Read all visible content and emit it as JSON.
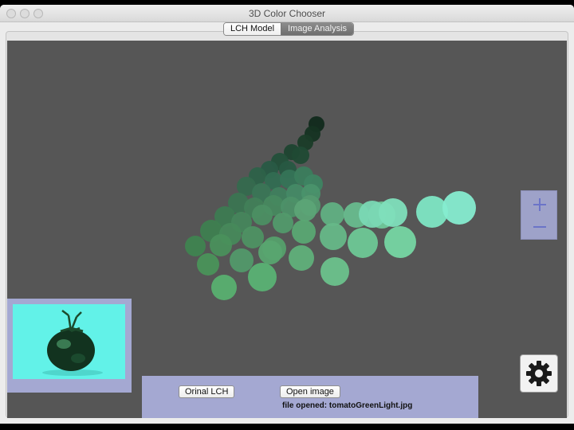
{
  "window": {
    "title": "3D Color Chooser"
  },
  "tabs": [
    {
      "label": "LCH Model",
      "active": false
    },
    {
      "label": "Image Analysis",
      "active": true
    }
  ],
  "zoom": {
    "plus_icon": "plus-icon",
    "minus_icon": "minus-icon"
  },
  "controls": {
    "original_lch_label": "Orinal LCH",
    "open_image_label": "Open image",
    "status_text": "file opened: tomatoGreenLight.jpg"
  },
  "thumbnail": {
    "subject": "green tomato with stem on cyan background"
  },
  "settings": {
    "icon": "gear-icon"
  },
  "colors": {
    "viewport_bg": "#565656",
    "panel_accent": "#a4a8d2",
    "thumb_bg": "#62f2e8",
    "tomato_dark": "#0e2a1a"
  }
}
